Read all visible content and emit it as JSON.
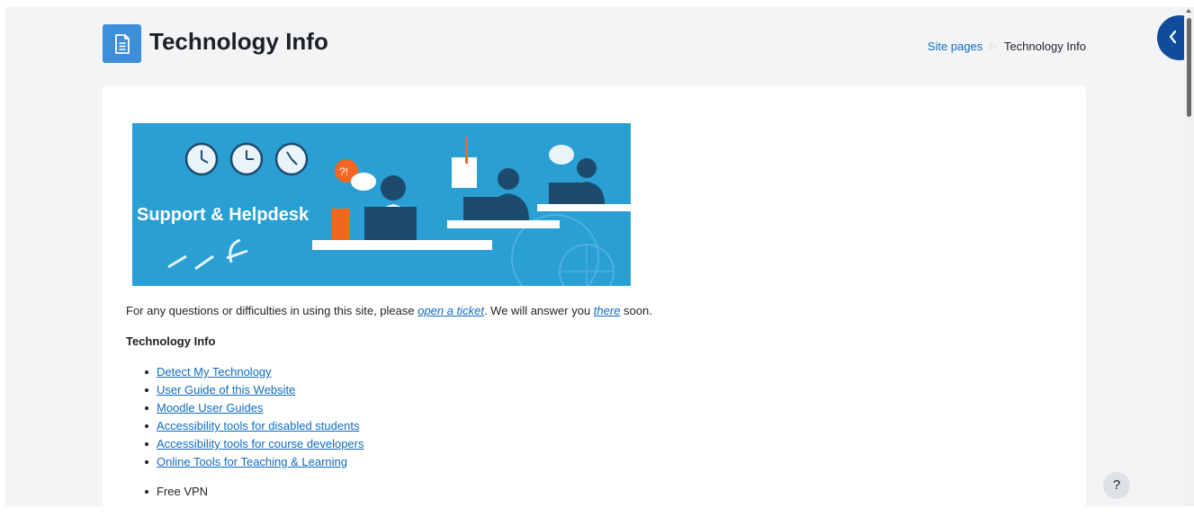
{
  "header": {
    "title": "Technology Info",
    "icon": "page-document-icon",
    "icon_color": "#3d8fd9"
  },
  "breadcrumb": {
    "items": [
      "Site pages",
      "Technology Info"
    ]
  },
  "drawer": {
    "icon": "chevron-left-icon",
    "color": "#0f4c9c"
  },
  "banner": {
    "text": "Support & Helpdesk",
    "background": "#2a9fd3"
  },
  "content": {
    "intro_before": "For any questions or difficulties in using this site, please ",
    "intro_link1": "open a ticket",
    "intro_middle": ". We will answer you ",
    "intro_link2": "there",
    "intro_after": " soon.",
    "section_heading": "Technology Info",
    "links": [
      "Detect My Technology",
      "User Guide of this Website",
      "Moodle User Guides",
      "Accessibility tools for disabled students",
      "Accessibility tools for course developers",
      "Online Tools for Teaching & Learning"
    ],
    "vpn_item": "Free VPN"
  },
  "help_button": {
    "label": "?",
    "icon": "help-icon"
  },
  "colors": {
    "link": "#0f6cbf",
    "page_background": "#f3f4f6",
    "card_background": "#ffffff"
  }
}
